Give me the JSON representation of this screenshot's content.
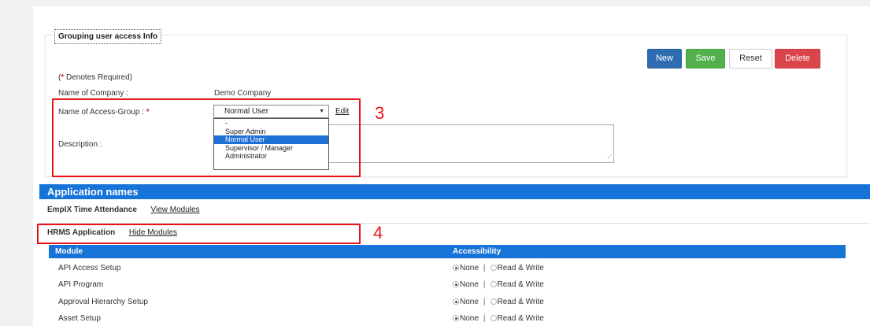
{
  "form": {
    "legend": "Grouping user access Info",
    "required_note_open": "(",
    "required_star": "*",
    "required_note_text": " Denotes Required)",
    "company_label": "Name of Company :",
    "company_value": "Demo Company",
    "access_group_label": "Name of Access-Group : ",
    "access_group_star": "*",
    "access_group_value": "Normal User",
    "access_group_options": [
      "-",
      "Super Admin",
      "Normal User",
      "Supervisor / Manager",
      "Administrator"
    ],
    "access_group_selected": "Normal User",
    "edit_link": "Edit",
    "description_label": "Description :",
    "description_value": ""
  },
  "toolbar": {
    "new_label": "New",
    "save_label": "Save",
    "reset_label": "Reset",
    "delete_label": "Delete"
  },
  "applications": {
    "header": "Application names",
    "items": [
      {
        "name": "EmpIX Time Attendance",
        "link": "View Modules"
      },
      {
        "name": "HRMS Application",
        "link": "Hide Modules"
      }
    ]
  },
  "modules": {
    "col_module": "Module",
    "col_access": "Accessibility",
    "option_none": "None",
    "option_rw": "Read & Write",
    "separator": "|",
    "rows": [
      {
        "name": "API Access Setup",
        "access": "None"
      },
      {
        "name": "API Program",
        "access": "None"
      },
      {
        "name": "Approval Hierarchy Setup",
        "access": "None"
      },
      {
        "name": "Asset Setup",
        "access": "None"
      }
    ]
  },
  "annotations": {
    "label_3": "3",
    "label_4": "4"
  },
  "colors": {
    "primary_blue": "#1673d8",
    "new_button": "#2f6db3",
    "save_button": "#52b04d",
    "delete_button": "#d9454a",
    "annotation_red": "#e8141a"
  }
}
